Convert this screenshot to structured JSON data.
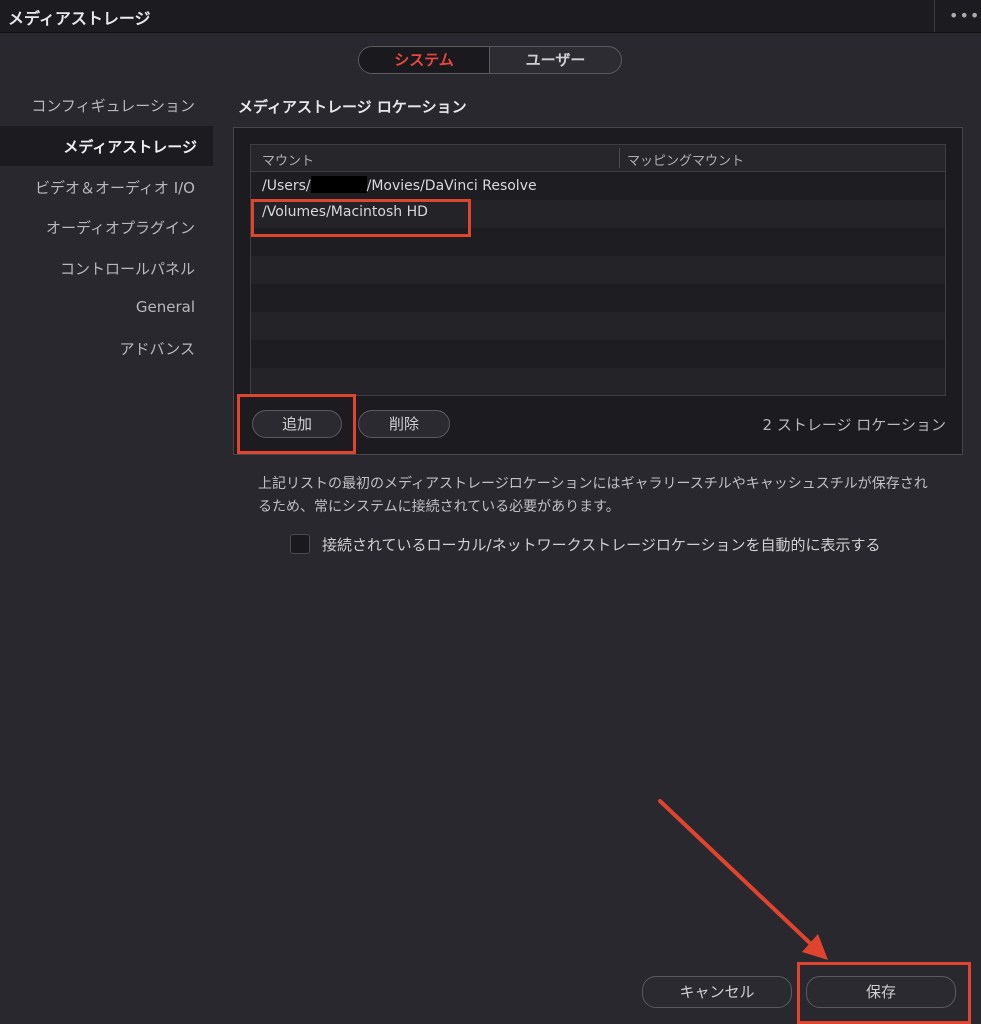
{
  "window": {
    "title": "メディアストレージ",
    "more_icon": "more-horizontal-icon"
  },
  "segment": {
    "system_label": "システム",
    "user_label": "ユーザー",
    "active": "system"
  },
  "sidebar": {
    "items": [
      {
        "label": "コンフィギュレーション"
      },
      {
        "label": "メディアストレージ"
      },
      {
        "label": "ビデオ＆オーディオ I/O"
      },
      {
        "label": "オーディオプラグイン"
      },
      {
        "label": "コントロールパネル"
      },
      {
        "label": "General"
      },
      {
        "label": "アドバンス"
      }
    ],
    "active_index": 1
  },
  "main": {
    "section_title": "メディアストレージ ロケーション",
    "table": {
      "columns": [
        "マウント",
        "マッピングマウント"
      ],
      "rows": [
        {
          "mount_prefix": "/Users/",
          "mount_suffix": "/Movies/DaVinci Resolve",
          "mapping": ""
        },
        {
          "mount": "/Volumes/Macintosh HD",
          "mapping": ""
        }
      ]
    },
    "add_label": "追加",
    "delete_label": "削除",
    "count_label": "2 ストレージ ロケーション",
    "description": "上記リストの最初のメディアストレージロケーションにはギャラリースチルやキャッシュスチルが保存されるため、常にシステムに接続されている必要があります。",
    "auto_show_label": "接続されているローカル/ネットワークストレージロケーションを自動的に表示する",
    "auto_show_checked": false
  },
  "footer": {
    "cancel_label": "キャンセル",
    "save_label": "保存"
  },
  "annotation_color": "#e0442f",
  "accent_color": "#e8473e"
}
